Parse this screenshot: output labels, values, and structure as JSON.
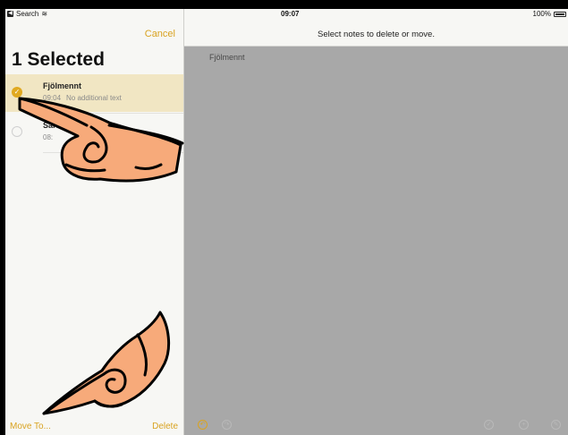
{
  "status_bar": {
    "back_label": "Search",
    "back_glyph": "◀",
    "wifi_glyph": "≋",
    "time": "09:07",
    "battery": "100%"
  },
  "sidebar": {
    "cancel_label": "Cancel",
    "title": "1 Selected",
    "notes": [
      {
        "title": "Fjölmennt",
        "time": "09:04",
        "preview": "No additional text",
        "selected": true
      },
      {
        "title": "Sar",
        "time": "08:",
        "preview": "",
        "selected": false
      }
    ],
    "move_to_label": "Move To...",
    "delete_label": "Delete"
  },
  "main": {
    "header_title": "Select notes to delete or move.",
    "note_preview_title": "Fjölmennt",
    "toolbar_icons": [
      "undo-icon",
      "redo-icon",
      "checklist-icon",
      "plus-icon",
      "pen-icon"
    ]
  },
  "colors": {
    "accent": "#d9a321",
    "selected_row": "#f1e6c3",
    "main_background": "#a8a8a8",
    "hand_skin": "#f7aa7a"
  }
}
